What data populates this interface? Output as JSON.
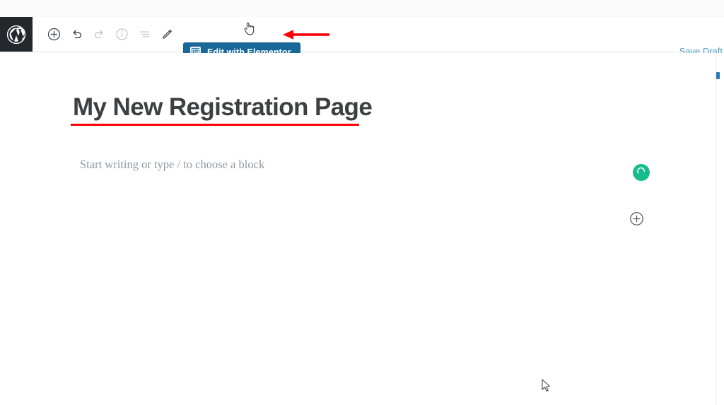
{
  "window": {
    "top_strip_color": "#fafafa"
  },
  "toolbar": {
    "logo_icon": "wordpress-logo-icon",
    "buttons": [
      {
        "name": "add-block-button",
        "icon": "plus-circle-icon",
        "label": "Add block",
        "disabled": false
      },
      {
        "name": "undo-button",
        "icon": "undo-icon",
        "label": "Undo",
        "disabled": false
      },
      {
        "name": "redo-button",
        "icon": "redo-icon",
        "label": "Redo",
        "disabled": true
      },
      {
        "name": "details-button",
        "icon": "info-circle-icon",
        "label": "Details",
        "disabled": true
      },
      {
        "name": "list-view-button",
        "icon": "list-view-icon",
        "label": "List view",
        "disabled": true
      },
      {
        "name": "edit-button",
        "icon": "pencil-icon",
        "label": "Edit",
        "disabled": false
      }
    ],
    "elementor": {
      "label": "Edit with Elementor",
      "icon": "elementor-panel-icon",
      "bg_color": "#1a6899",
      "text_color": "#ffffff"
    },
    "save_draft_label": "Save Draft",
    "save_draft_color": "#4d9fc4"
  },
  "annotation": {
    "arrow_name": "red-annotation-arrow",
    "arrow_color": "#fb0007",
    "underline_name": "red-annotation-underline",
    "underline_color": "#fb0007"
  },
  "editor": {
    "post_title": "My New Registration Page",
    "post_title_color": "#3c4043",
    "block_placeholder": "Start writing or type / to choose a block",
    "placeholder_color": "#8f98a1",
    "status_badge": {
      "name": "saving-spinner-badge",
      "color": "#18bc8c",
      "icon": "spinner-arc-icon"
    },
    "inserter": {
      "name": "block-inserter-button",
      "icon": "plus-circle-icon"
    }
  },
  "scrollbar": {
    "thumb_color": "#2a7bb0"
  },
  "cursors": {
    "pointer_icon": "arrow-cursor-icon",
    "hand_icon": "hand-pointer-cursor-icon"
  }
}
